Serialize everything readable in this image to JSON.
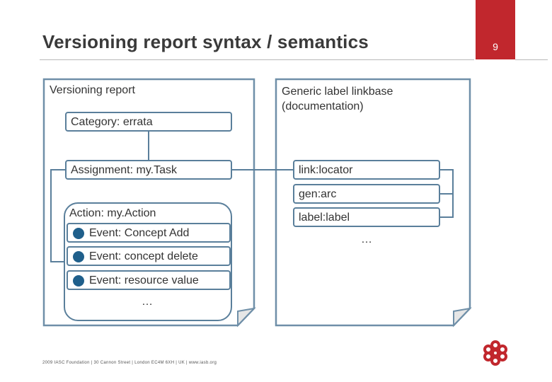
{
  "title": "Versioning report syntax / semantics",
  "page_number": "9",
  "left_doc": {
    "label": "Versioning report",
    "category": "Category: errata",
    "assignment": "Assignment: my.Task",
    "action": "Action: my.Action",
    "events": [
      "Event: Concept Add",
      "Event: concept delete",
      "Event: resource value"
    ],
    "ellipsis": "…"
  },
  "right_doc": {
    "label_line1": "Generic label linkbase",
    "label_line2": "(documentation)",
    "items": [
      "link:locator",
      "gen:arc",
      "label:label"
    ],
    "ellipsis": "…"
  },
  "footer": "2009 IASC Foundation  |  30 Cannon Street  |  London EC4M 6XH  |  UK  |  www.iasb.org",
  "colors": {
    "accent": "#c1272d",
    "box_border": "#5a7f9b",
    "event_dot": "#1f5f8b",
    "doc_border": "#6f8fa8"
  }
}
